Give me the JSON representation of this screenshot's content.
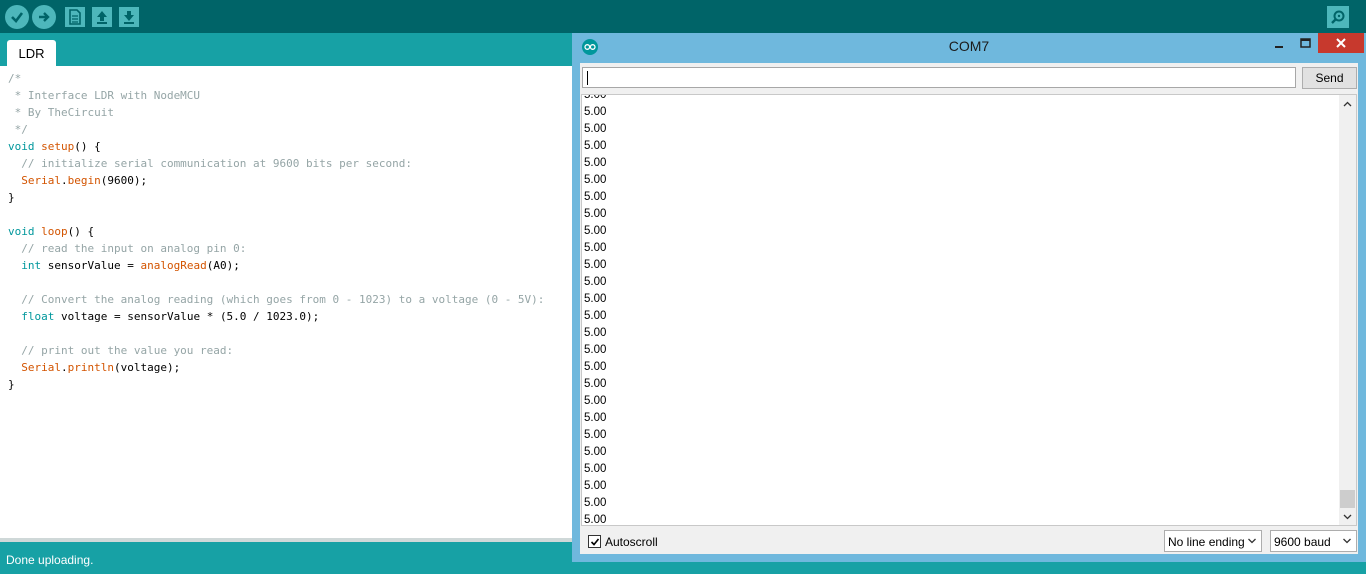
{
  "toolbar": {
    "icons": [
      "verify-icon",
      "upload-icon",
      "new-icon",
      "open-icon",
      "save-icon",
      "serial-monitor-icon"
    ]
  },
  "editor": {
    "tab_label": "LDR",
    "code_lines": [
      "/*",
      " * Interface LDR with NodeMCU",
      " * By TheCircuit",
      " */",
      "void setup() {",
      "  // initialize serial communication at 9600 bits per second:",
      "  Serial.begin(9600);",
      "}",
      "",
      "void loop() {",
      "  // read the input on analog pin 0:",
      "  int sensorValue = analogRead(A0);",
      "",
      "  // Convert the analog reading (which goes from 0 - 1023) to a voltage (0 - 5V):",
      "  float voltage = sensorValue * (5.0 / 1023.0);",
      "",
      "  // print out the value you read:",
      "  Serial.println(voltage);",
      "}"
    ]
  },
  "status": {
    "text": "Done uploading."
  },
  "serial_monitor": {
    "title": "COM7",
    "input_value": "",
    "send_label": "Send",
    "output_lines": [
      "5.00",
      "5.00",
      "5.00",
      "5.00",
      "5.00",
      "5.00",
      "5.00",
      "5.00",
      "5.00",
      "5.00",
      "5.00",
      "5.00",
      "5.00",
      "5.00",
      "5.00",
      "5.00",
      "5.00",
      "5.00",
      "5.00",
      "5.00",
      "5.00",
      "5.00",
      "5.00",
      "5.00",
      "5.00",
      "5.00",
      "5.00",
      "5.0"
    ],
    "autoscroll_label": "Autoscroll",
    "autoscroll_checked": true,
    "line_ending": "No line ending",
    "baud": "9600 baud",
    "colors": {
      "title_bar": "#6fb8dd",
      "close_button": "#c7392d"
    }
  },
  "colors": {
    "toolbar": "#006468",
    "tabbar": "#17a1a5",
    "comment": "#95a5a6",
    "keyword": "#00979c",
    "function": "#d35400"
  }
}
